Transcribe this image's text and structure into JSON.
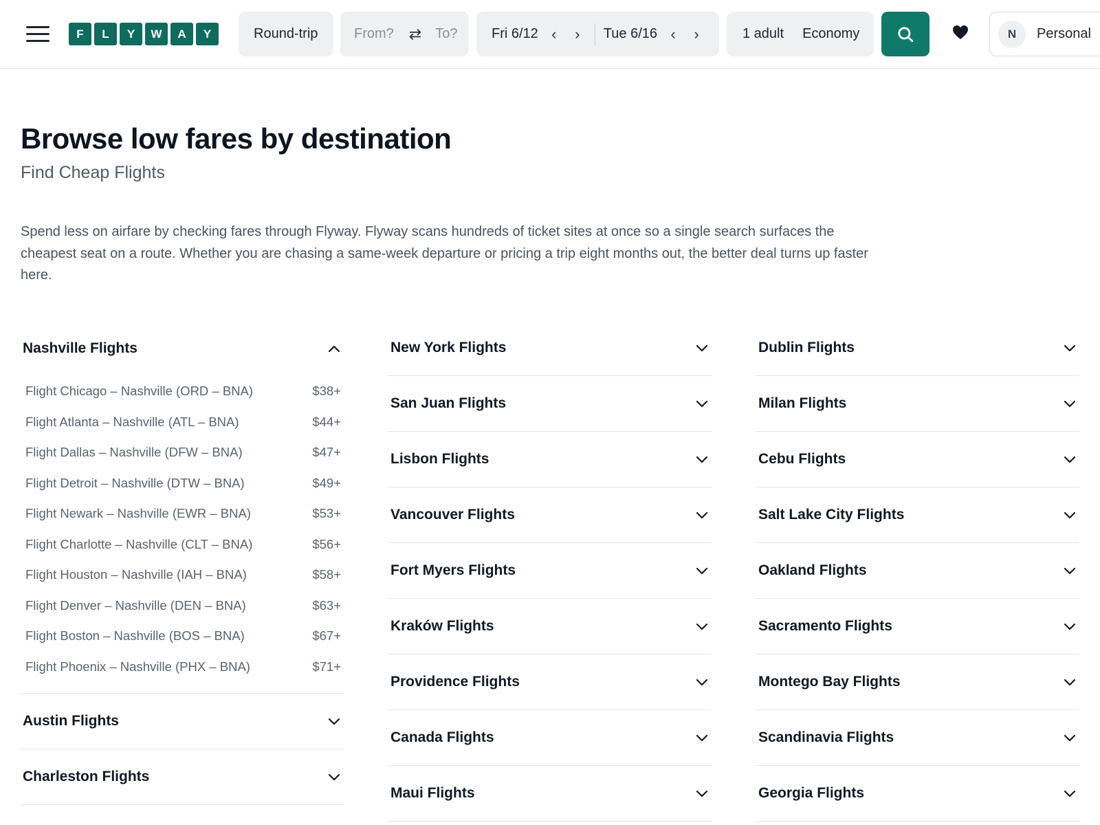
{
  "header": {
    "logo_letters": [
      "F",
      "L",
      "Y",
      "W",
      "A",
      "Y"
    ],
    "trip_type": "Round-trip",
    "from_placeholder": "From?",
    "to_placeholder": "To?",
    "depart_date": "Fri 6/12",
    "return_date": "Tue 6/16",
    "travelers": "1 adult",
    "cabin": "Economy",
    "avatar_initial": "N",
    "account_label": "Personal",
    "brand_color": "#0f6b5d",
    "search_color": "#0f7a6a"
  },
  "hero": {
    "title": "Browse low fares by destination",
    "subtitle": "Find Cheap Flights",
    "intro": "Spend less on airfare by checking fares through Flyway. Flyway scans hundreds of ticket sites at once so a single search surfaces the cheapest seat on a route. Whether you are chasing a same-week departure or pricing a trip eight months out, the better deal turns up faster here."
  },
  "columns": [
    [
      {
        "title": "Nashville Flights",
        "expanded": true,
        "routes": [
          {
            "name": "Flight Chicago – Nashville (ORD – BNA)",
            "price": "$38+"
          },
          {
            "name": "Flight Atlanta – Nashville (ATL – BNA)",
            "price": "$44+"
          },
          {
            "name": "Flight Dallas – Nashville (DFW – BNA)",
            "price": "$47+"
          },
          {
            "name": "Flight Detroit – Nashville (DTW – BNA)",
            "price": "$49+"
          },
          {
            "name": "Flight Newark – Nashville (EWR – BNA)",
            "price": "$53+"
          },
          {
            "name": "Flight Charlotte – Nashville (CLT – BNA)",
            "price": "$56+"
          },
          {
            "name": "Flight Houston – Nashville (IAH – BNA)",
            "price": "$58+"
          },
          {
            "name": "Flight Denver – Nashville (DEN – BNA)",
            "price": "$63+"
          },
          {
            "name": "Flight Boston – Nashville (BOS – BNA)",
            "price": "$67+"
          },
          {
            "name": "Flight Phoenix – Nashville (PHX – BNA)",
            "price": "$71+"
          }
        ]
      },
      {
        "title": "Austin Flights",
        "expanded": false
      },
      {
        "title": "Charleston Flights",
        "expanded": false
      }
    ],
    [
      {
        "title": "New York Flights",
        "expanded": false
      },
      {
        "title": "San Juan Flights",
        "expanded": false
      },
      {
        "title": "Lisbon Flights",
        "expanded": false
      },
      {
        "title": "Vancouver Flights",
        "expanded": false
      },
      {
        "title": "Fort Myers Flights",
        "expanded": false
      },
      {
        "title": "Kraków Flights",
        "expanded": false
      },
      {
        "title": "Providence Flights",
        "expanded": false
      },
      {
        "title": "Canada Flights",
        "expanded": false
      },
      {
        "title": "Maui Flights",
        "expanded": false
      }
    ],
    [
      {
        "title": "Dublin Flights",
        "expanded": false
      },
      {
        "title": "Milan Flights",
        "expanded": false
      },
      {
        "title": "Cebu Flights",
        "expanded": false
      },
      {
        "title": "Salt Lake City Flights",
        "expanded": false
      },
      {
        "title": "Oakland Flights",
        "expanded": false
      },
      {
        "title": "Sacramento Flights",
        "expanded": false
      },
      {
        "title": "Montego Bay Flights",
        "expanded": false
      },
      {
        "title": "Scandinavia Flights",
        "expanded": false
      },
      {
        "title": "Georgia Flights",
        "expanded": false
      }
    ]
  ]
}
